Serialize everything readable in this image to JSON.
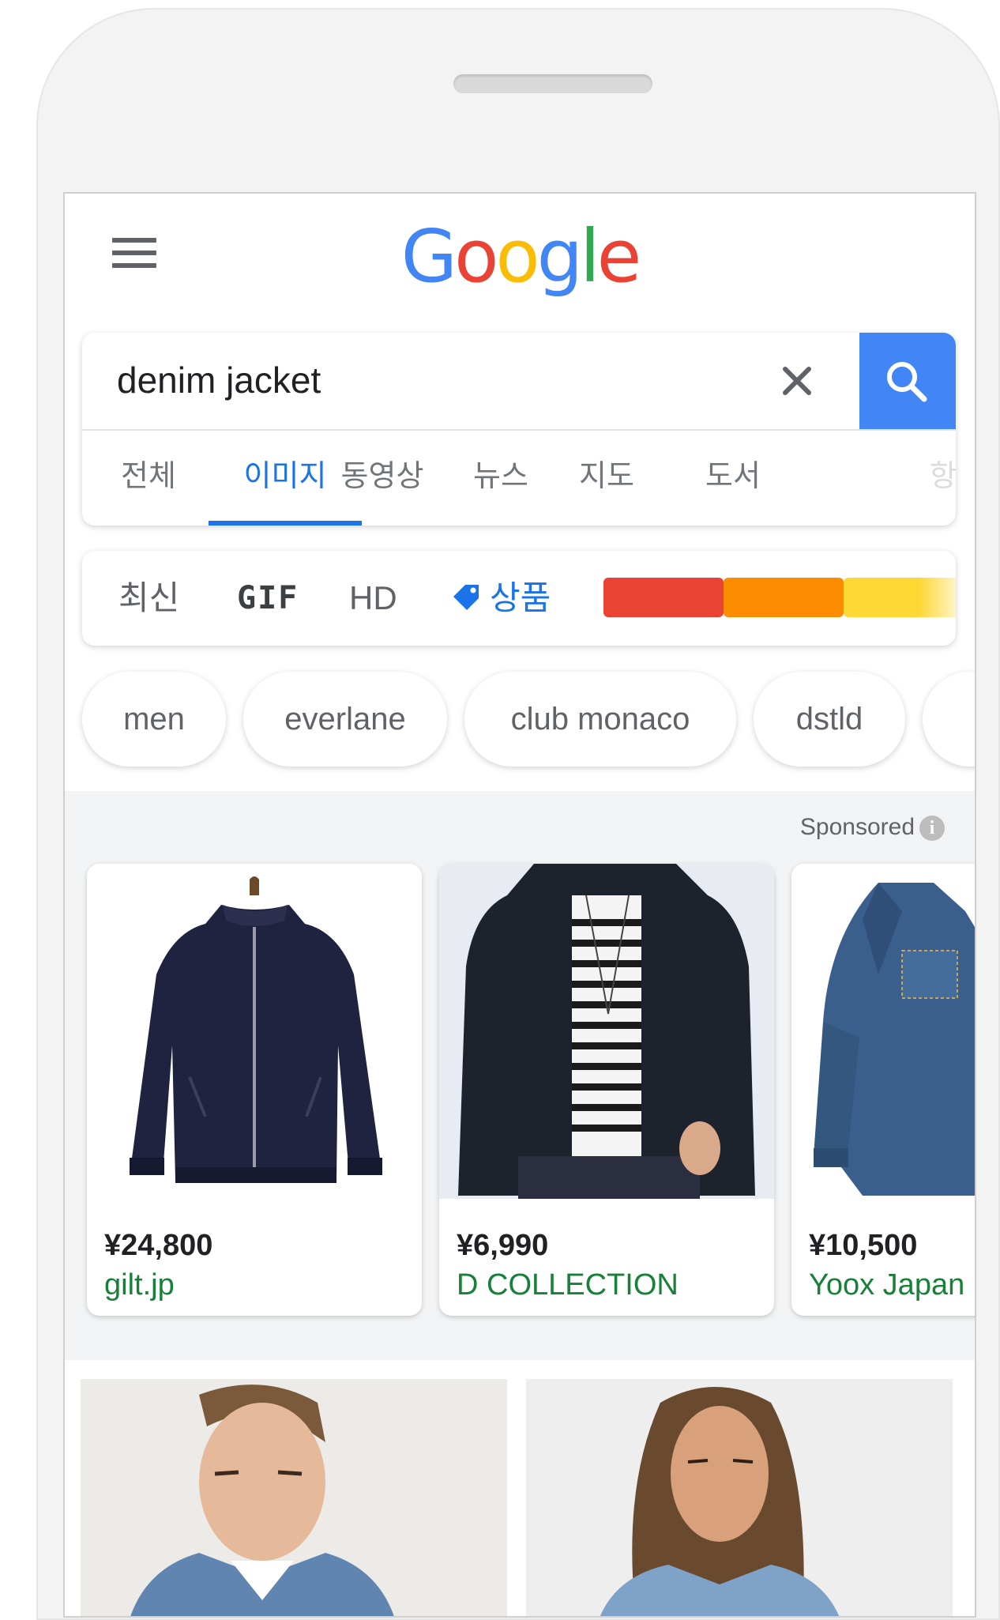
{
  "logo": {
    "letters": [
      "G",
      "o",
      "o",
      "g",
      "l",
      "e"
    ],
    "colors": [
      "#4285f4",
      "#ea4335",
      "#fbbc05",
      "#4285f4",
      "#34a853",
      "#ea4335"
    ]
  },
  "search": {
    "query": "denim jacket",
    "icons": [
      "close-icon",
      "search-icon"
    ]
  },
  "tabs": [
    {
      "label": "전체",
      "active": false
    },
    {
      "label": "이미지",
      "active": true
    },
    {
      "label": "동영상",
      "active": false
    },
    {
      "label": "뉴스",
      "active": false
    },
    {
      "label": "지도",
      "active": false
    },
    {
      "label": "도서",
      "active": false
    },
    {
      "label": "항",
      "active": false
    }
  ],
  "filters": {
    "recent": "최신",
    "gif": "GIF",
    "hd": "HD",
    "products": "상품",
    "color_swatches": [
      "#ea4335",
      "#fb8c00",
      "#fdd835"
    ]
  },
  "chips": [
    "men",
    "everlane",
    "club monaco",
    "dstld"
  ],
  "shopping": {
    "sponsored_label": "Sponsored",
    "products": [
      {
        "price": "¥24,800",
        "store": "gilt.jp",
        "image": "navy bomber jacket"
      },
      {
        "price": "¥6,990",
        "store": "D COLLECTION",
        "image": "man in black bomber jacket"
      },
      {
        "price": "¥10,500",
        "store": "Yoox Japan",
        "image": "denim jacket"
      }
    ]
  },
  "image_results": [
    {
      "image": "man in denim jacket"
    },
    {
      "image": "woman in denim jacket"
    }
  ],
  "accent_color": "#1a73e8",
  "price_store_color": "#188038"
}
